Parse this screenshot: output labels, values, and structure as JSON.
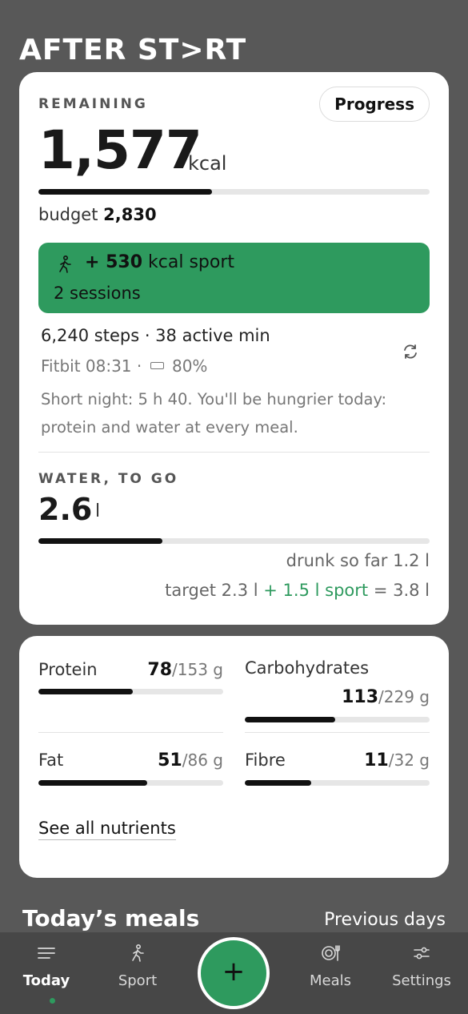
{
  "app": {
    "logo_text": "AFTER ST>RT"
  },
  "calories": {
    "remaining_label": "REMAINING",
    "progress_button": "Progress",
    "remaining_value": "1,577",
    "unit": "kcal",
    "budget_label": "budget",
    "budget_value": "2,830",
    "consumed_fraction": 0.443
  },
  "sport": {
    "amount": "+ 530",
    "unit_text": "kcal sport",
    "sessions": "2 sessions",
    "icon": "walking-person-icon",
    "color": "#2e9a5e"
  },
  "activity": {
    "steps_line": "6,240 steps · 38 active min",
    "device_line": "Fitbit 08:31 ·",
    "battery": "80%",
    "note": "Short night: 5 h 40. You'll be hungrier today: protein and water at every meal."
  },
  "water": {
    "label": "WATER, TO GO",
    "value": "2.6",
    "unit": "l",
    "drunk_fraction": 0.316,
    "drunk_text": "drunk so far 1.2 l",
    "target_prefix": "target 2.3 l",
    "target_sport": "+ 1.5 l sport",
    "target_suffix": "= 3.8 l"
  },
  "nutrients": {
    "items": [
      {
        "name": "Protein",
        "value": "78",
        "target": "/153 g",
        "fraction": 0.51
      },
      {
        "name": "Carbohydrates",
        "value": "113",
        "target": "/229 g",
        "fraction": 0.49
      },
      {
        "name": "Fat",
        "value": "51",
        "target": "/86 g",
        "fraction": 0.59
      },
      {
        "name": "Fibre",
        "value": "11",
        "target": "/32 g",
        "fraction": 0.36
      }
    ],
    "see_all": "See all nutrients"
  },
  "meals": {
    "title": "Today’s meals",
    "previous_days": "Previous days"
  },
  "nav": {
    "items": [
      {
        "label": "Today",
        "icon": "menu-lines-icon"
      },
      {
        "label": "Sport",
        "icon": "running-icon"
      },
      {
        "label": "Meals",
        "icon": "plate-cutlery-icon"
      },
      {
        "label": "Settings",
        "icon": "sliders-icon"
      }
    ],
    "add": "+"
  }
}
